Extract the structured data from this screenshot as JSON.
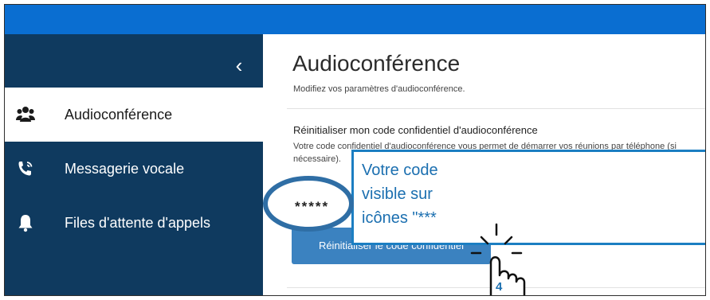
{
  "sidebar": {
    "collapse_icon": "chevron-left-icon",
    "items": [
      {
        "label": "Audioconférence",
        "icon": "people-icon",
        "active": true
      },
      {
        "label": "Messagerie vocale",
        "icon": "phone-ringing-icon",
        "active": false
      },
      {
        "label": "Files d'attente d'appels",
        "icon": "bell-icon",
        "active": false
      }
    ]
  },
  "main": {
    "title": "Audioconférence",
    "subtitle": "Modifiez vos paramètres d'audioconférence.",
    "section": {
      "title": "Réinitialiser mon code confidentiel d'audioconférence",
      "description": "Votre code confidentiel d'audioconférence vous permet de démarrer vos réunions par téléphone (si nécessaire).",
      "pin_mask": "*****",
      "reset_button": "Réinitialiser le code confidentiel"
    }
  },
  "annotation": {
    "callout_lines": [
      "Votre code",
      "visible sur",
      "icônes \"***"
    ],
    "step_number": "4"
  },
  "colors": {
    "topbar": "#0a6ed1",
    "sidebar": "#0f3a5f",
    "button": "#3b82c0",
    "annotation": "#1b7ec2"
  }
}
